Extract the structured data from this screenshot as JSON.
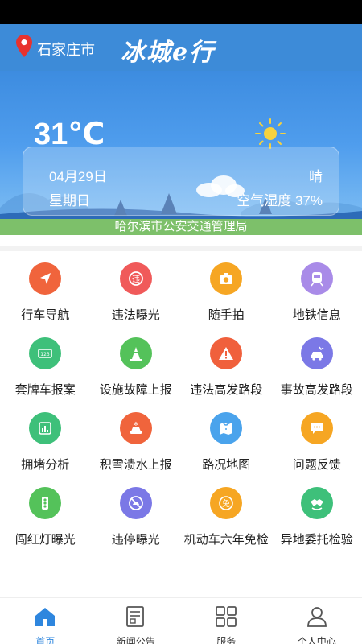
{
  "header": {
    "city": "石家庄市",
    "brand": "冰城e行"
  },
  "weather": {
    "temperature": "31℃",
    "date": "04月29日",
    "weekday": "星期日",
    "condition": "晴",
    "humidity": "空气湿度 37%"
  },
  "department": "哈尔滨市公安交通管理局",
  "grid": [
    {
      "label": "行车导航",
      "icon": "navigation-arrow-icon",
      "color": "#f0643c"
    },
    {
      "label": "违法曝光",
      "icon": "violation-icon",
      "color": "#f05a5a"
    },
    {
      "label": "随手拍",
      "icon": "camera-icon",
      "color": "#f6a623"
    },
    {
      "label": "地铁信息",
      "icon": "subway-icon",
      "color": "#a98be8"
    },
    {
      "label": "套牌车报案",
      "icon": "license-plate-icon",
      "color": "#3ec07a"
    },
    {
      "label": "设施故障上报",
      "icon": "traffic-cone-icon",
      "color": "#54c25a"
    },
    {
      "label": "违法高发路段",
      "icon": "warning-icon",
      "color": "#f0603c"
    },
    {
      "label": "事故高发路段",
      "icon": "car-crash-icon",
      "color": "#7b78e6"
    },
    {
      "label": "拥堵分析",
      "icon": "congestion-chart-icon",
      "color": "#3ec07a"
    },
    {
      "label": "积雪溃水上报",
      "icon": "snow-car-icon",
      "color": "#f0643c"
    },
    {
      "label": "路况地图",
      "icon": "map-icon",
      "color": "#4aa3ec"
    },
    {
      "label": "问题反馈",
      "icon": "feedback-icon",
      "color": "#f6a623"
    },
    {
      "label": "闯红灯曝光",
      "icon": "traffic-light-icon",
      "color": "#54c25a"
    },
    {
      "label": "违停曝光",
      "icon": "no-parking-icon",
      "color": "#7b78e6"
    },
    {
      "label": "机动车六年免检",
      "icon": "exempt-badge-icon",
      "color": "#f6a623"
    },
    {
      "label": "异地委托检验",
      "icon": "handshake-icon",
      "color": "#3ec07a"
    }
  ],
  "tabs": [
    {
      "label": "首页",
      "icon": "home-icon",
      "active": true
    },
    {
      "label": "新闻公告",
      "icon": "news-icon",
      "active": false
    },
    {
      "label": "服务",
      "icon": "services-grid-icon",
      "active": false
    },
    {
      "label": "个人中心",
      "icon": "user-icon",
      "active": false
    }
  ]
}
